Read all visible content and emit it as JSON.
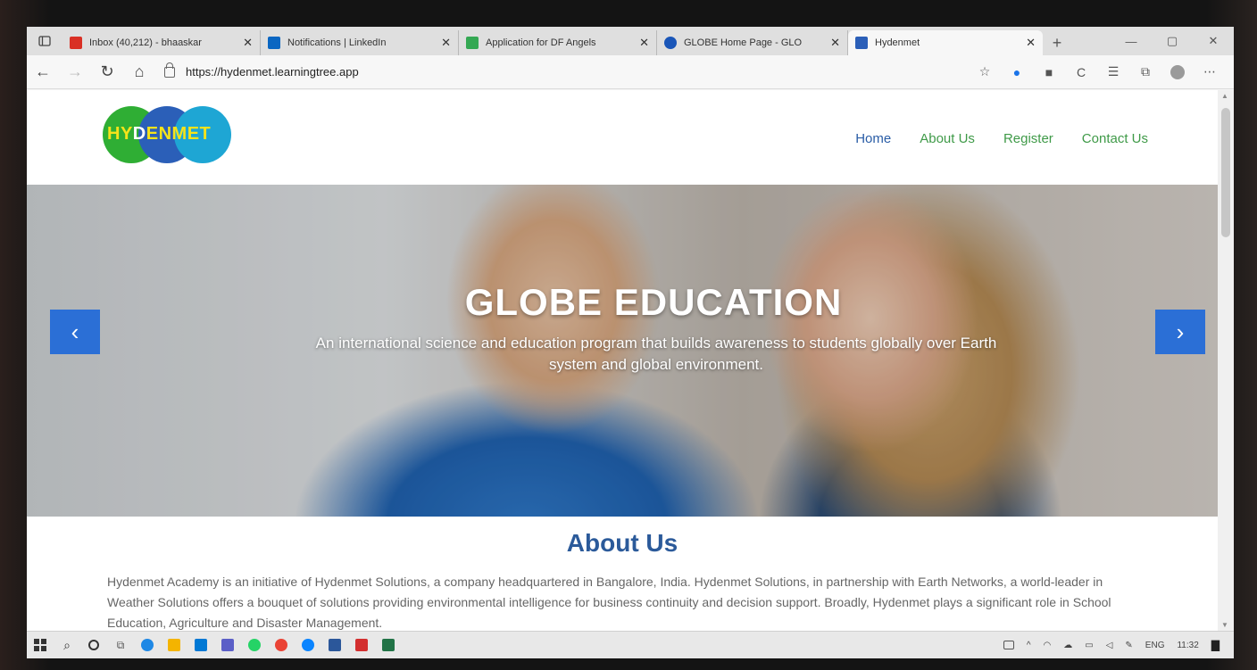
{
  "browser": {
    "tabs": [
      {
        "title": "Inbox (40,212) - bhaaskar",
        "favicon_color": "#d93025",
        "active": false
      },
      {
        "title": "Notifications | LinkedIn",
        "favicon_color": "#0a66c2",
        "active": false
      },
      {
        "title": "Application for DF Angels",
        "favicon_color": "#34a853",
        "active": false
      },
      {
        "title": "GLOBE Home Page - GLO",
        "favicon_color": "#1a56b8",
        "active": false
      },
      {
        "title": "Hydenmet",
        "favicon_color": "#2b5fb8",
        "active": true
      }
    ],
    "url": "https://hydenmet.learningtree.app"
  },
  "site": {
    "logo_prefix": "HY",
    "logo_middle": "D",
    "logo_suffix": "ENMET",
    "nav": [
      "Home",
      "About Us",
      "Register",
      "Contact Us"
    ]
  },
  "hero": {
    "title": "GLOBE EDUCATION",
    "subtitle": "An international science and education program that builds awareness to students globally over Earth system and global environment.",
    "prev_glyph": "‹",
    "next_glyph": "›"
  },
  "about": {
    "heading": "About Us",
    "text": "Hydenmet Academy is an initiative of Hydenmet Solutions, a company headquartered in Bangalore, India. Hydenmet Solutions, in partnership with Earth Networks, a world-leader in Weather Solutions offers a bouquet of solutions providing environmental intelligence for business continuity and decision support. Broadly, Hydenmet plays a significant role in School Education, Agriculture and Disaster Management."
  },
  "taskbar": {
    "language": "ENG",
    "time": "11:32",
    "app_colors": [
      "#1e88e5",
      "#f4b400",
      "#0078d4",
      "#5b5fc7",
      "#25d366",
      "#ea4335",
      "#0a84ff",
      "#2b579a",
      "#d32f2f",
      "#217346"
    ]
  }
}
